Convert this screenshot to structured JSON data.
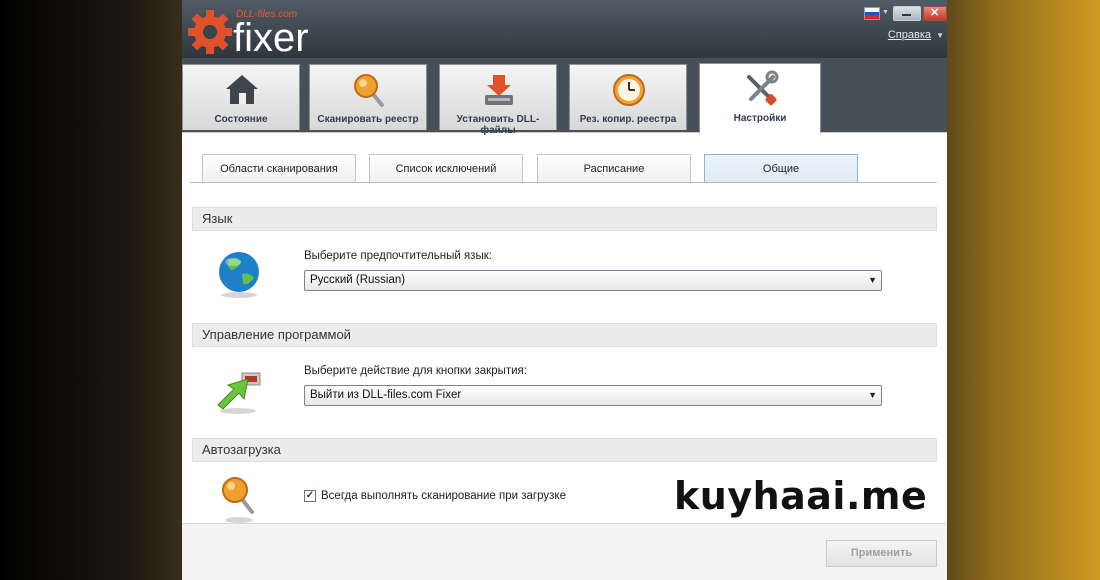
{
  "app": {
    "logo_small": "DLL-files.com",
    "logo_big": "fixer"
  },
  "window": {
    "help": "Справка"
  },
  "main_tabs": [
    {
      "label": "Состояние",
      "icon": "home-icon"
    },
    {
      "label": "Сканировать реестр",
      "icon": "magnifier-icon"
    },
    {
      "label": "Установить DLL-файлы",
      "icon": "install-icon"
    },
    {
      "label": "Рез. копир. реестра",
      "icon": "clock-backup-icon"
    },
    {
      "label": "Настройки",
      "icon": "tools-icon",
      "active": true
    }
  ],
  "sub_tabs": [
    {
      "label": "Области сканирования"
    },
    {
      "label": "Список исключений"
    },
    {
      "label": "Расписание"
    },
    {
      "label": "Общие",
      "active": true
    }
  ],
  "sections": {
    "language": {
      "title": "Язык",
      "label": "Выберите предпочтительный язык:",
      "value": "Русский (Russian)",
      "icon": "globe-icon"
    },
    "program": {
      "title": "Управление программой",
      "label": "Выберите действие для кнопки закрытия:",
      "value": "Выйти из DLL-files.com Fixer",
      "icon": "exit-arrow-icon"
    },
    "autoload": {
      "title": "Автозагрузка",
      "checkbox_label": "Всегда выполнять сканирование при загрузке",
      "checked": true,
      "icon": "magnifier-icon"
    }
  },
  "footer": {
    "apply": "Применить"
  },
  "watermark": "kuyhaai.me",
  "colors": {
    "titlebar": "#3b434b",
    "accent": "#e0522a",
    "active_subtab": "#dfeaf4"
  }
}
